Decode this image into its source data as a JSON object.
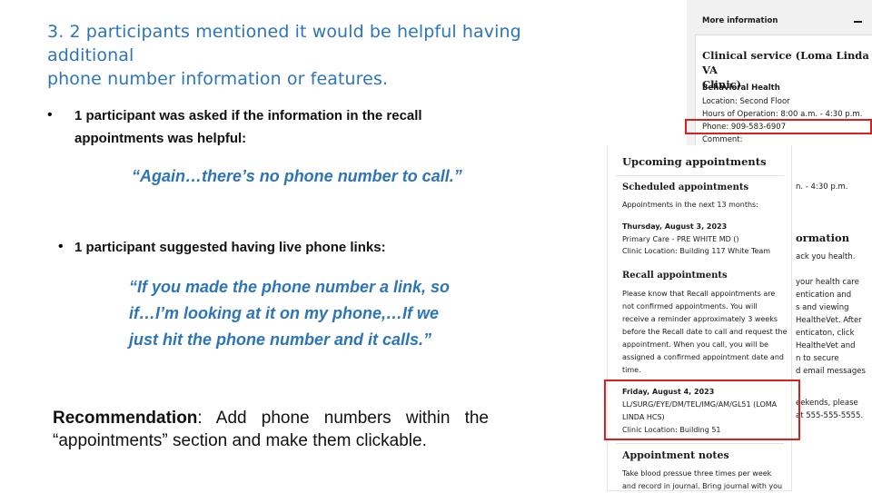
{
  "heading": {
    "line1": "3. 2 participants mentioned it would be helpful having additional",
    "line2": "phone number information or features."
  },
  "finding1": {
    "bullet": "•",
    "line1": "1 participant was asked if the information in the recall",
    "line2": "appointments was helpful:",
    "quote": "“Again…there’s no phone number to call.”"
  },
  "finding2": {
    "bullet": "•",
    "text": "1 participant suggested having live phone links:",
    "quote_line1": "“If you made the phone number a link, so",
    "quote_line2": "if…I’m looking at it on my phone,…If we",
    "quote_line3": "just hit the phone number and it calls.”"
  },
  "recommendation": {
    "label": "Recommendation",
    "text": ": Add phone numbers within the “appointments” section and make them clickable."
  },
  "more_info_panel": {
    "header": "More information",
    "toggle_icon": "minus-icon",
    "service_title_line1": "Clinical service (Loma Linda VA",
    "service_title_line2": "Clinic)",
    "subheading": "Behavioral Health",
    "location": "Location: Second Floor",
    "hours": "Hours of Operation: 8:00 a.m. - 4:30 p.m.",
    "phone": "Phone: 909-583-6907",
    "comment": "Comment:"
  },
  "background_fragments": {
    "hours_frag": "n. - 4:30 p.m.",
    "info_frag": "ormation",
    "track_frag": "ack you health.",
    "lines": [
      "your health care",
      "entication and",
      "s and viewing",
      "HealtheVet. After",
      "enticaton, click",
      "HealtheVet and",
      "n to secure",
      "d email messages"
    ],
    "weekends_line1": "eekends, please",
    "weekends_line2": "at 555-555-5555."
  },
  "appointments_panel": {
    "title": "Upcoming appointments",
    "scheduled_heading": "Scheduled appointments",
    "scheduled_sub": "Appointments in the next 13 months:",
    "appt1_date": "Thursday, August 3, 2023",
    "appt1_line1": "Primary Care - PRE WHITE MD ()",
    "appt1_line2": "Clinic Location: Building 117 White Team",
    "recall_heading": "Recall appointments",
    "recall_text": [
      "Please know that Recall appointments are",
      "not confirmed appointments. You will",
      "receive a reminder approximately 3 weeks",
      "before the Recall date to call and request the",
      "appointment. When you call, you will be",
      "assigned a confirmed appointment date and",
      "time."
    ],
    "appt2_date": "Friday, August 4, 2023",
    "appt2_line1": "LL/SURG/EYE/DM/TEL/IMG/AM/GL51 (LOMA",
    "appt2_line2": "LINDA HCS)",
    "appt2_line3": "Clinic Location: Building 51",
    "notes_heading": "Appointment notes",
    "notes_line1": "Take blood pressue three times per week",
    "notes_line2": "and record in journal. Bring journal with you"
  },
  "colors": {
    "accent_blue": "#2e75b6",
    "highlight_red": "#d9201f"
  }
}
